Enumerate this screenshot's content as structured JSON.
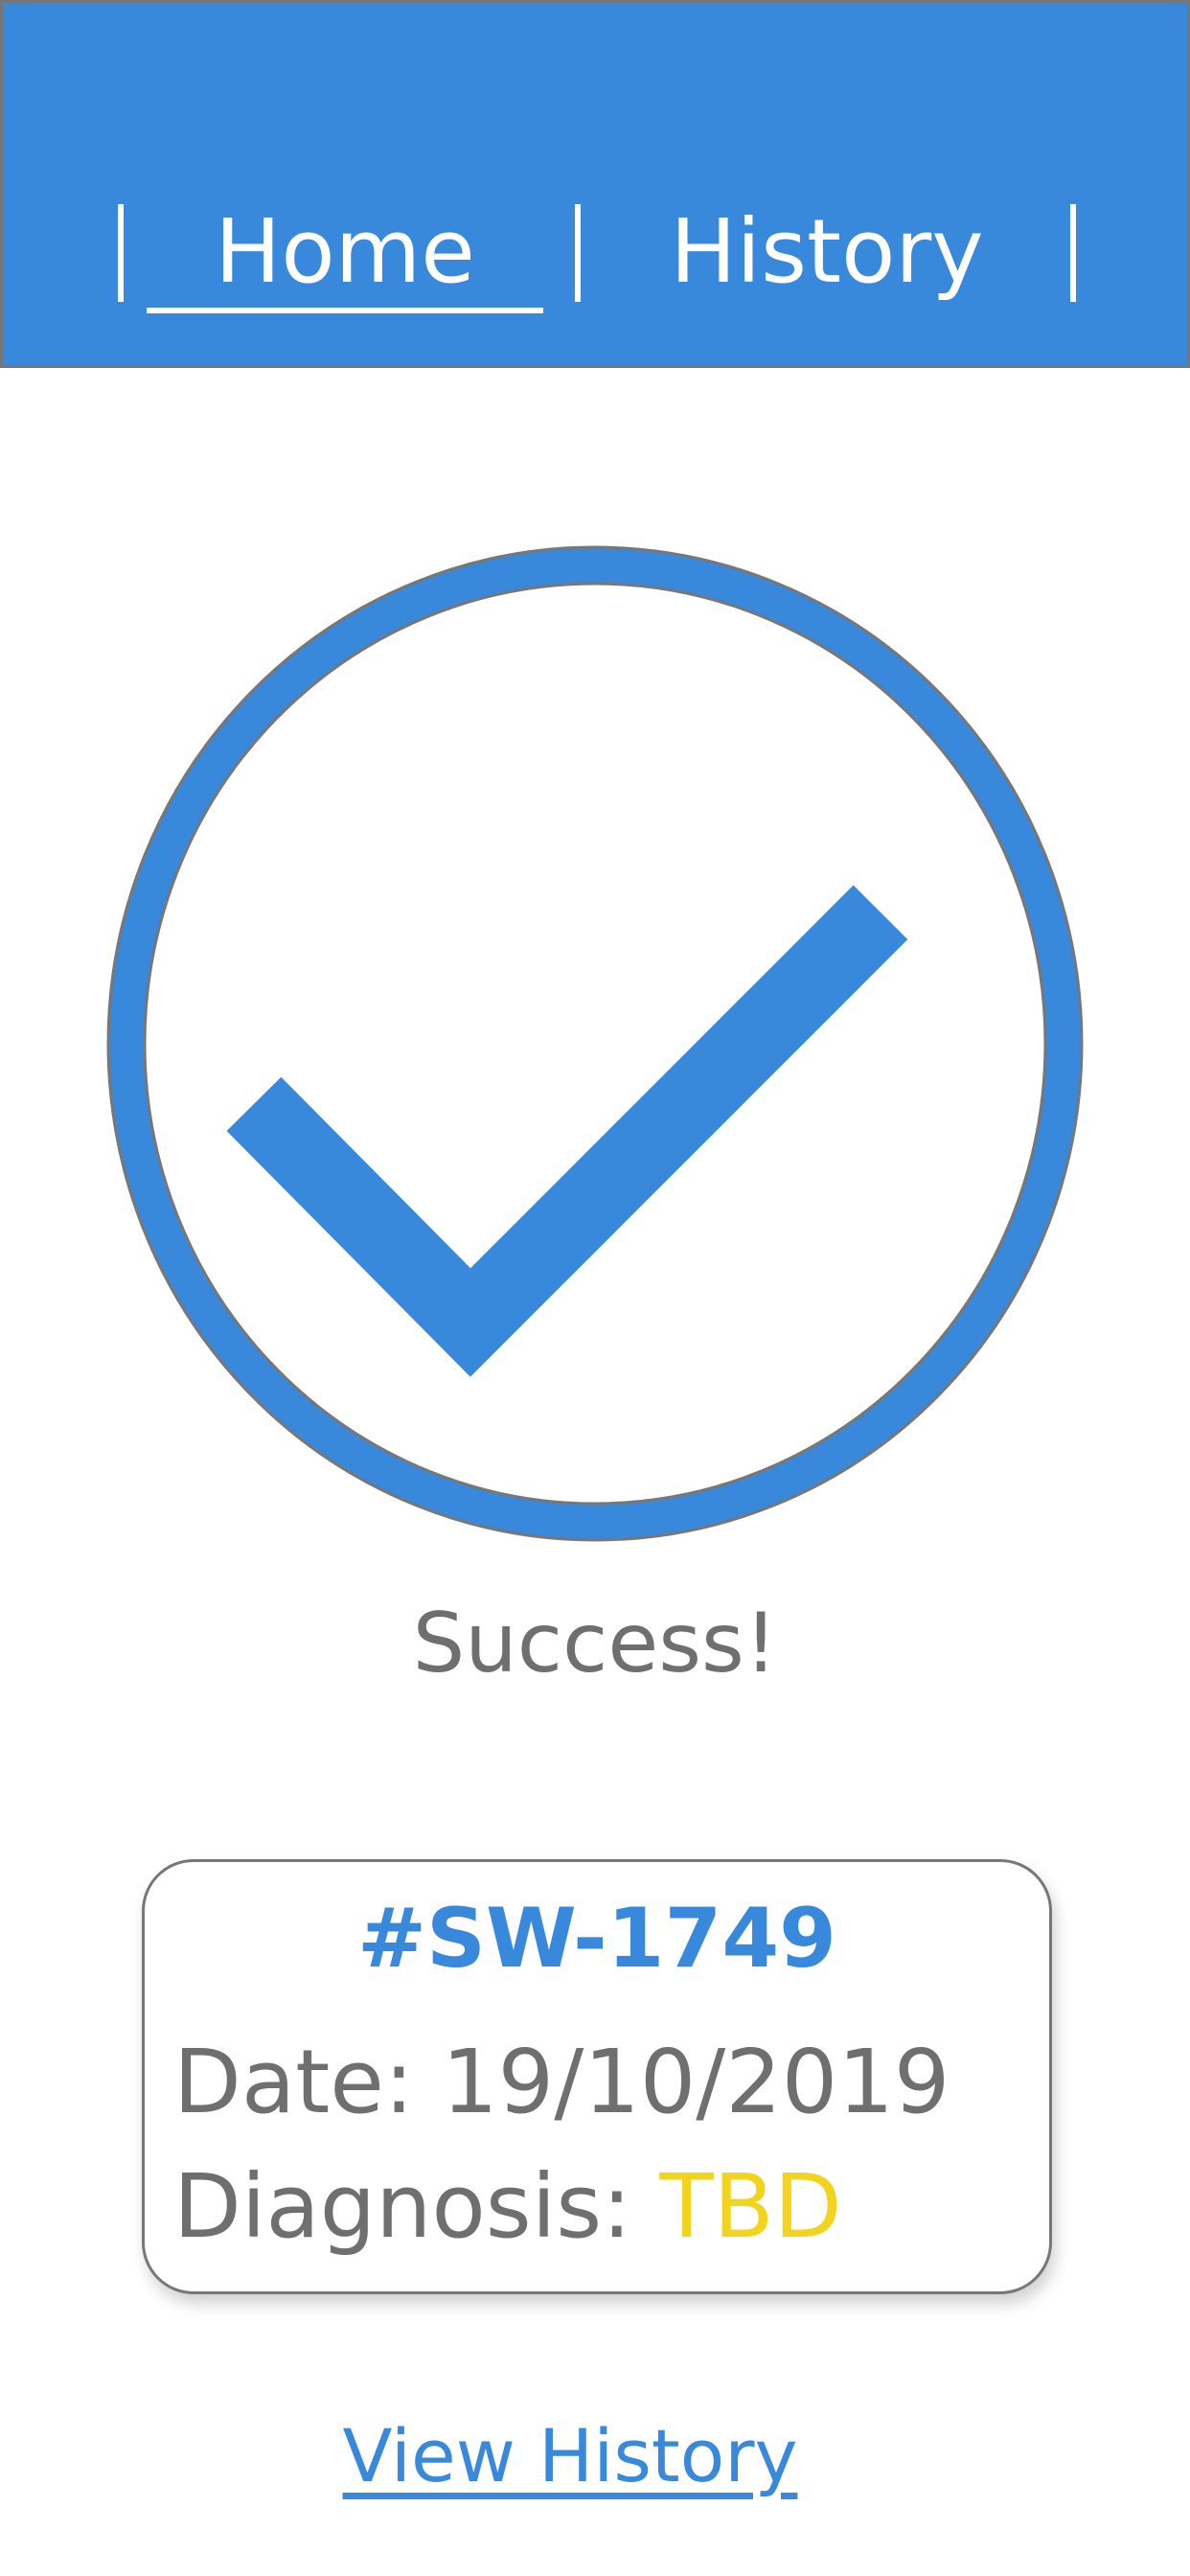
{
  "header": {
    "separator": "|",
    "tabs": [
      {
        "label": "Home",
        "active": true
      },
      {
        "label": "History",
        "active": false
      }
    ],
    "color": "#3888DB"
  },
  "status": {
    "icon": "checkmark-circle-icon",
    "text": "Success!"
  },
  "record": {
    "id": "#SW-1749",
    "date_label": "Date:",
    "date_value": "19/10/2019",
    "diagnosis_label": "Diagnosis:",
    "diagnosis_value": "TBD",
    "diagnosis_color": "#F2D41E"
  },
  "links": {
    "view_history": "View History"
  }
}
